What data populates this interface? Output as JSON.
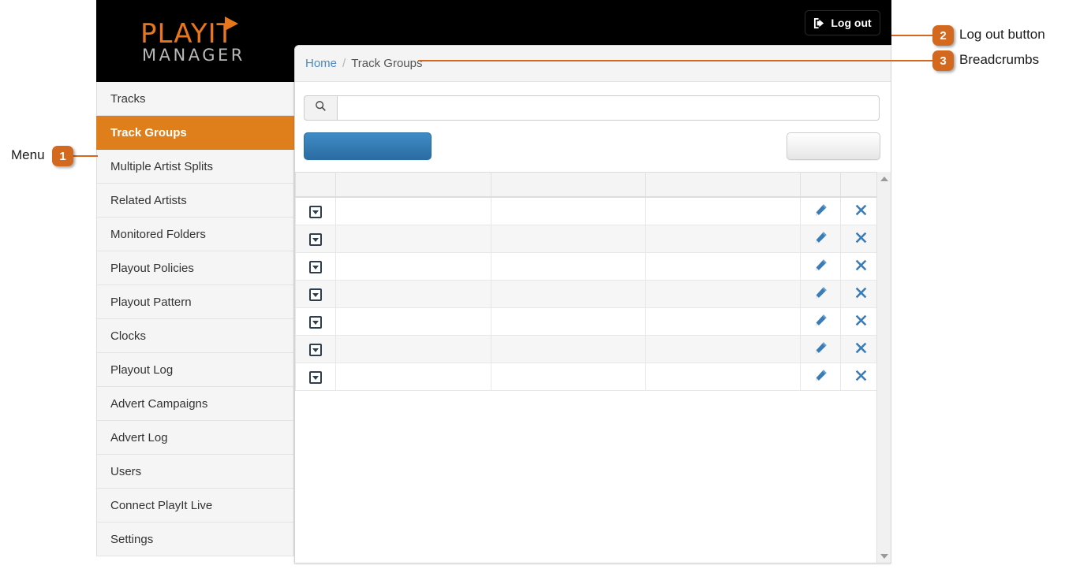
{
  "app": {
    "logo_primary": "PLAYIT",
    "logo_secondary": "MANAGER",
    "logout_label": "Log out"
  },
  "sidebar": {
    "items": [
      {
        "label": "Tracks",
        "active": false
      },
      {
        "label": "Track Groups",
        "active": true
      },
      {
        "label": "Multiple Artist Splits",
        "active": false
      },
      {
        "label": "Related Artists",
        "active": false
      },
      {
        "label": "Monitored Folders",
        "active": false
      },
      {
        "label": "Playout Policies",
        "active": false
      },
      {
        "label": "Playout Pattern",
        "active": false
      },
      {
        "label": "Clocks",
        "active": false
      },
      {
        "label": "Playout Log",
        "active": false
      },
      {
        "label": "Advert Campaigns",
        "active": false
      },
      {
        "label": "Advert Log",
        "active": false
      },
      {
        "label": "Users",
        "active": false
      },
      {
        "label": "Connect PlayIt Live",
        "active": false
      },
      {
        "label": "Settings",
        "active": false
      }
    ]
  },
  "breadcrumb": {
    "home": "Home",
    "separator": "/",
    "current": "Track Groups"
  },
  "search": {
    "value": "",
    "placeholder": "",
    "icon": "search-icon"
  },
  "toolbar": {
    "primary_label": "",
    "secondary_label": ""
  },
  "table": {
    "headers": [
      "",
      "",
      "",
      "",
      "",
      ""
    ],
    "rows": [
      {
        "expand": "",
        "a": "",
        "b": "",
        "c": "",
        "edit": "",
        "delete": ""
      },
      {
        "expand": "",
        "a": "",
        "b": "",
        "c": "",
        "edit": "",
        "delete": ""
      },
      {
        "expand": "",
        "a": "",
        "b": "",
        "c": "",
        "edit": "",
        "delete": ""
      },
      {
        "expand": "",
        "a": "",
        "b": "",
        "c": "",
        "edit": "",
        "delete": ""
      },
      {
        "expand": "",
        "a": "",
        "b": "",
        "c": "",
        "edit": "",
        "delete": ""
      },
      {
        "expand": "",
        "a": "",
        "b": "",
        "c": "",
        "edit": "",
        "delete": ""
      },
      {
        "expand": "",
        "a": "",
        "b": "",
        "c": "",
        "edit": "",
        "delete": ""
      }
    ]
  },
  "annotations": [
    {
      "number": "1",
      "label": "Menu"
    },
    {
      "number": "2",
      "label": "Log out button"
    },
    {
      "number": "3",
      "label": "Breadcrumbs"
    }
  ],
  "colors": {
    "brand_orange": "#df7f1b",
    "logo_orange": "#e9761b",
    "annotation_orange": "#d2691e",
    "link_blue": "#4a89c4",
    "primary_button_blue": "#2b6ca2",
    "icon_blue": "#3a7cb5",
    "topbar_black": "#000000"
  }
}
